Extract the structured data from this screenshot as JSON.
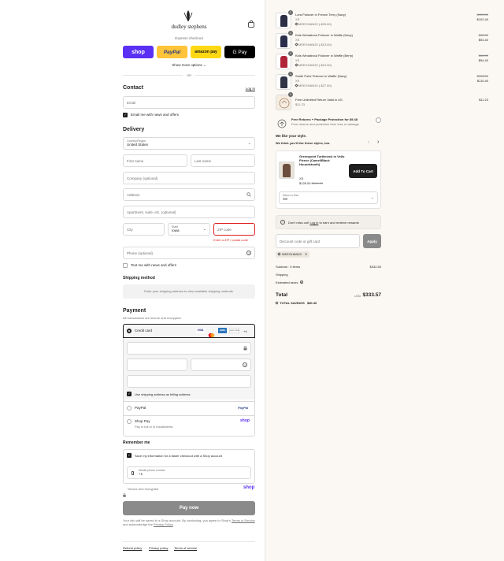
{
  "brand": {
    "name": "dudley stephens"
  },
  "express": {
    "title": "Express checkout",
    "shop_label": "shop",
    "paypal_label": "PayPal",
    "amazon_label": "amazon pay",
    "gpay_label": "G Pay",
    "show_more": "Show more options ⌄",
    "or": "OR"
  },
  "contact": {
    "title": "Contact",
    "login": "Log in",
    "email_placeholder": "Email",
    "email_news": "Email me with news and offers"
  },
  "delivery": {
    "title": "Delivery",
    "country_label": "Country/Region",
    "country_value": "United States",
    "first_name": "First name",
    "last_name": "Last name",
    "company": "Company (optional)",
    "address": "Address",
    "apartment": "Apartment, suite, etc. (optional)",
    "city": "City",
    "state_label": "State",
    "state_value": "Iowa",
    "zip": "ZIP code",
    "zip_error": "Enter a ZIP / postal code",
    "phone": "Phone (optional)",
    "text_news": "Text me with news and offers"
  },
  "shipping": {
    "title": "Shipping method",
    "message": "Enter your shipping address to view available shipping methods."
  },
  "payment": {
    "title": "Payment",
    "subtitle": "All transactions are secure and encrypted.",
    "credit_card": "Credit card",
    "more_cards": "+4",
    "card_logos": [
      "VISA",
      "MC",
      "AMEX",
      "DISCOVER"
    ],
    "billing_same": "Use shipping address as billing address",
    "paypal": "PayPal",
    "paypal_logo": "PayPal",
    "shop_pay": "Shop Pay",
    "shop_pay_sub": "Pay in full or in installments",
    "shop_pay_logo": "shop"
  },
  "remember": {
    "title": "Remember me",
    "save_info": "Save my information for a faster checkout with a Shop account",
    "phone_label": "Mobile phone number",
    "phone_value": "+1",
    "secure": "Secure and encrypted",
    "shop_logo": "shop"
  },
  "pay_now": "Pay now",
  "legal": {
    "text1": "Your info will be saved to a Shop account. By continuing, you agree to Shop's",
    "terms": "Terms of Service",
    "text2": "and acknowledge the",
    "privacy": "Privacy Policy",
    "end": "."
  },
  "footer": {
    "refund": "Refund policy",
    "privacy": "Privacy policy",
    "terms": "Terms of service"
  },
  "cart": {
    "items": [
      {
        "name": "Lora Pullover in French Terry (Navy)",
        "variant": "XS",
        "code": "MEEGHAN20 (-$25.60)",
        "old": "$128.00",
        "price": "$102.40",
        "qty": "1",
        "color": "#2b2f45"
      },
      {
        "name": "Kids Windabout Pullover in Waffle (Navy)",
        "variant": "XS",
        "code": "MEEGHAN20 (-$13.60)",
        "old": "$68.00",
        "price": "$54.40",
        "qty": "1",
        "color": "#2a2e4a"
      },
      {
        "name": "Kids Windabout Pullover in Waffle (Berry)",
        "variant": "XS",
        "code": "MEEGHAN20 (-$13.60)",
        "old": "$68.00",
        "price": "$54.40",
        "qty": "1",
        "color": "#b0243a"
      },
      {
        "name": "Smith Point Pullover in Waffle (Navy)",
        "variant": "XS",
        "code": "MEEGHAN20 (-$27.60)",
        "old": "$138.00",
        "price": "$110.40",
        "qty": "1",
        "color": "#2f3447"
      }
    ],
    "return_item": {
      "name": "Free Unlimited Return Valid in US.",
      "sub": "$11.23",
      "price": "$11.23",
      "qty": "1"
    }
  },
  "protection": {
    "title": "Free Returns + Package Protection for $9.48",
    "sub": "Free returns and protection from loss or damage"
  },
  "upsell": {
    "title": "We like your style.",
    "subtitle": "We think you'll like these styles, too.",
    "product": "Greenpoint Turtleneck in Vello Fleece (Camel/Black Houndstooth)",
    "size": "XS",
    "price": "$128.00",
    "old_price": "$160.00",
    "add_button": "Add To Cart",
    "select_label": "Select a Size",
    "select_value": "XS"
  },
  "rewards": {
    "pre": "Don't miss out!",
    "login": "Log in",
    "post": "to earn and redeem rewards"
  },
  "discount": {
    "placeholder": "Discount code or gift card",
    "apply": "Apply",
    "applied_code": "MEEGHAN20"
  },
  "totals": {
    "subtotal_label": "Subtotal · 5 items",
    "subtotal": "$332.83",
    "shipping_label": "Shipping",
    "taxes_label": "Estimated taxes",
    "total_label": "Total",
    "currency": "USD",
    "total": "$333.57",
    "savings_label": "TOTAL SAVINGS",
    "savings": "$80.40"
  },
  "colors": {
    "shop": "#5a31f4",
    "paypal": "#ffc439",
    "amazon": "#ffd814",
    "gpay": "#000000",
    "pay_now": "#8a8a8a",
    "error": "#dd1d1d"
  }
}
